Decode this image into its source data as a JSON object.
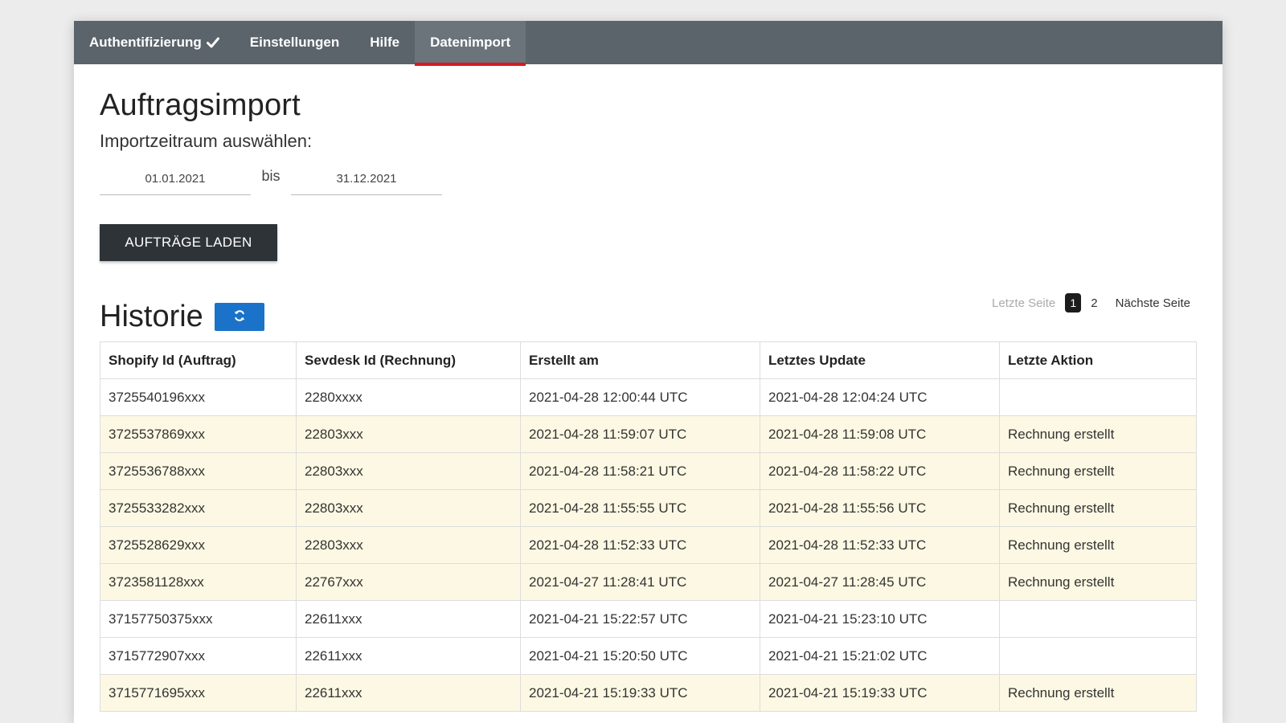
{
  "nav": {
    "items": [
      {
        "label": "Authentifizierung",
        "icon": "checkmark-icon"
      },
      {
        "label": "Einstellungen"
      },
      {
        "label": "Hilfe"
      },
      {
        "label": "Datenimport",
        "active": true
      }
    ]
  },
  "import": {
    "title": "Auftragsimport",
    "subtitle": "Importzeitraum auswählen:",
    "date_from": "01.01.2021",
    "separator": "bis",
    "date_to": "31.12.2021",
    "load_button": "AUFTRÄGE LADEN"
  },
  "history": {
    "title": "Historie",
    "refresh_icon": "refresh-icon",
    "pagination": {
      "prev": "Letzte Seite",
      "pages": [
        "1",
        "2"
      ],
      "current": "1",
      "next": "Nächste Seite"
    },
    "columns": [
      "Shopify Id (Auftrag)",
      "Sevdesk Id (Rechnung)",
      "Erstellt am",
      "Letztes Update",
      "Letzte Aktion"
    ],
    "rows": [
      {
        "shopify": "3725540196xxx",
        "sevdesk": "2280xxxx",
        "created": "2021-04-28 12:00:44 UTC",
        "updated": "2021-04-28 12:04:24 UTC",
        "action": "",
        "highlight": false
      },
      {
        "shopify": "3725537869xxx",
        "sevdesk": "22803xxx",
        "created": "2021-04-28 11:59:07 UTC",
        "updated": "2021-04-28 11:59:08 UTC",
        "action": "Rechnung erstellt",
        "highlight": true
      },
      {
        "shopify": "3725536788xxx",
        "sevdesk": "22803xxx",
        "created": "2021-04-28 11:58:21 UTC",
        "updated": "2021-04-28 11:58:22 UTC",
        "action": "Rechnung erstellt",
        "highlight": true
      },
      {
        "shopify": "3725533282xxx",
        "sevdesk": "22803xxx",
        "created": "2021-04-28 11:55:55 UTC",
        "updated": "2021-04-28 11:55:56 UTC",
        "action": "Rechnung erstellt",
        "highlight": true
      },
      {
        "shopify": "3725528629xxx",
        "sevdesk": "22803xxx",
        "created": "2021-04-28 11:52:33 UTC",
        "updated": "2021-04-28 11:52:33 UTC",
        "action": "Rechnung erstellt",
        "highlight": true
      },
      {
        "shopify": "3723581128xxx",
        "sevdesk": "22767xxx",
        "created": "2021-04-27 11:28:41 UTC",
        "updated": "2021-04-27 11:28:45 UTC",
        "action": "Rechnung erstellt",
        "highlight": true
      },
      {
        "shopify": "37157750375xxx",
        "sevdesk": "22611xxx",
        "created": "2021-04-21 15:22:57 UTC",
        "updated": "2021-04-21 15:23:10 UTC",
        "action": "",
        "highlight": false
      },
      {
        "shopify": "3715772907xxx",
        "sevdesk": "22611xxx",
        "created": "2021-04-21 15:20:50 UTC",
        "updated": "2021-04-21 15:21:02 UTC",
        "action": "",
        "highlight": false
      },
      {
        "shopify": "3715771695xxx",
        "sevdesk": "22611xxx",
        "created": "2021-04-21 15:19:33 UTC",
        "updated": "2021-04-21 15:19:33 UTC",
        "action": "Rechnung erstellt",
        "highlight": true
      }
    ]
  }
}
